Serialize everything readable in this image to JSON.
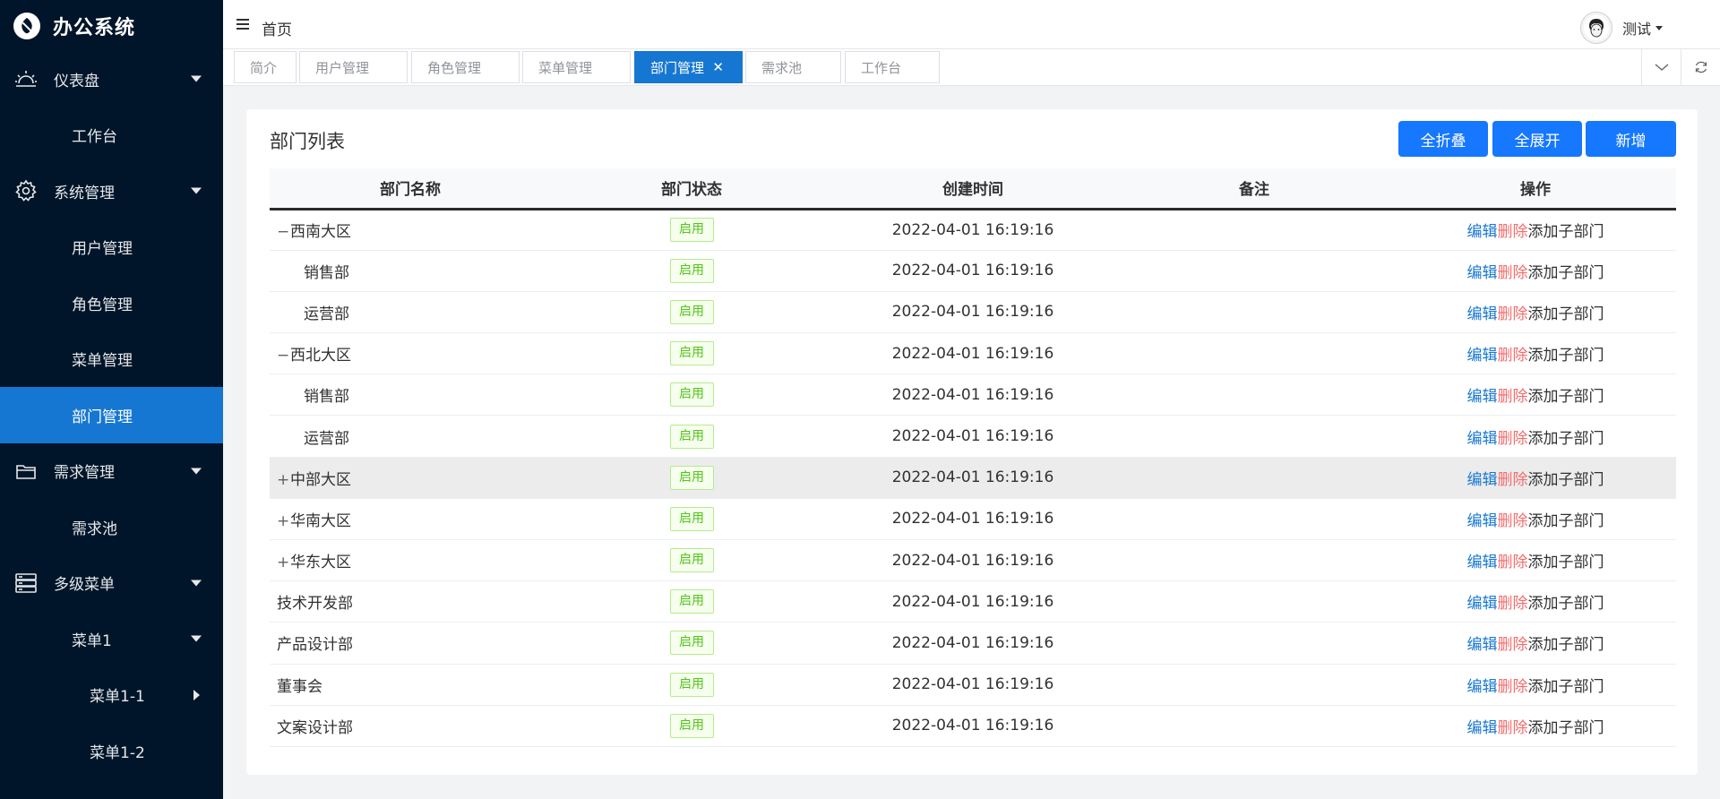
{
  "app": {
    "title": "办公系统"
  },
  "sidebar": {
    "items": [
      {
        "label": "仪表盘",
        "icon": "dashboard-sunrise-icon",
        "level": 0,
        "expandable": true
      },
      {
        "label": "工作台",
        "level": 1
      },
      {
        "label": "系统管理",
        "icon": "gear-icon",
        "level": 0,
        "expandable": true
      },
      {
        "label": "用户管理",
        "level": 1
      },
      {
        "label": "角色管理",
        "level": 1
      },
      {
        "label": "菜单管理",
        "level": 1
      },
      {
        "label": "部门管理",
        "level": 1,
        "active": true
      },
      {
        "label": "需求管理",
        "icon": "folder-icon",
        "level": 0,
        "expandable": true
      },
      {
        "label": "需求池",
        "level": 1
      },
      {
        "label": "多级菜单",
        "icon": "server-stack-icon",
        "level": 0,
        "expandable": true
      },
      {
        "label": "菜单1",
        "level": 1,
        "expandable": true
      },
      {
        "label": "菜单1-1",
        "level": 2,
        "arrow": "right"
      },
      {
        "label": "菜单1-2",
        "level": 2
      }
    ]
  },
  "header": {
    "breadcrumb": "首页",
    "user": {
      "name": "测试"
    }
  },
  "tabs": [
    {
      "label": "简介"
    },
    {
      "label": "用户管理"
    },
    {
      "label": "角色管理"
    },
    {
      "label": "菜单管理"
    },
    {
      "label": "部门管理",
      "active": true,
      "close": "✕"
    },
    {
      "label": "需求池"
    },
    {
      "label": "工作台"
    }
  ],
  "card": {
    "title": "部门列表",
    "buttons": {
      "collapse_all": "全折叠",
      "expand_all": "全展开",
      "add": "新增"
    }
  },
  "table": {
    "columns": [
      "部门名称",
      "部门状态",
      "创建时间",
      "备注",
      "操作"
    ],
    "actions": {
      "edit": "编辑",
      "delete": "删除",
      "add_child": "添加子部门"
    },
    "rows": [
      {
        "name": "西南大区",
        "toggle": "−",
        "status": "启用",
        "created": "2022-04-01 16:19:16",
        "remark": ""
      },
      {
        "name": "销售部",
        "child": true,
        "status": "启用",
        "created": "2022-04-01 16:19:16",
        "remark": ""
      },
      {
        "name": "运营部",
        "child": true,
        "status": "启用",
        "created": "2022-04-01 16:19:16",
        "remark": ""
      },
      {
        "name": "西北大区",
        "toggle": "−",
        "status": "启用",
        "created": "2022-04-01 16:19:16",
        "remark": ""
      },
      {
        "name": "销售部",
        "child": true,
        "status": "启用",
        "created": "2022-04-01 16:19:16",
        "remark": ""
      },
      {
        "name": "运营部",
        "child": true,
        "status": "启用",
        "created": "2022-04-01 16:19:16",
        "remark": ""
      },
      {
        "name": "中部大区",
        "toggle": "+",
        "status": "启用",
        "created": "2022-04-01 16:19:16",
        "remark": "",
        "highlight": true
      },
      {
        "name": "华南大区",
        "toggle": "+",
        "status": "启用",
        "created": "2022-04-01 16:19:16",
        "remark": ""
      },
      {
        "name": "华东大区",
        "toggle": "+",
        "status": "启用",
        "created": "2022-04-01 16:19:16",
        "remark": ""
      },
      {
        "name": "技术开发部",
        "status": "启用",
        "created": "2022-04-01 16:19:16",
        "remark": ""
      },
      {
        "name": "产品设计部",
        "status": "启用",
        "created": "2022-04-01 16:19:16",
        "remark": ""
      },
      {
        "name": "董事会",
        "status": "启用",
        "created": "2022-04-01 16:19:16",
        "remark": ""
      },
      {
        "name": "文案设计部",
        "status": "启用",
        "created": "2022-04-01 16:19:16",
        "remark": ""
      }
    ]
  },
  "colors": {
    "sidebar_bg": "#001529",
    "primary": "#1677ff",
    "active_menu": "#1677d2",
    "delete": "#f56c6c",
    "tag_green": "#52c41a"
  }
}
